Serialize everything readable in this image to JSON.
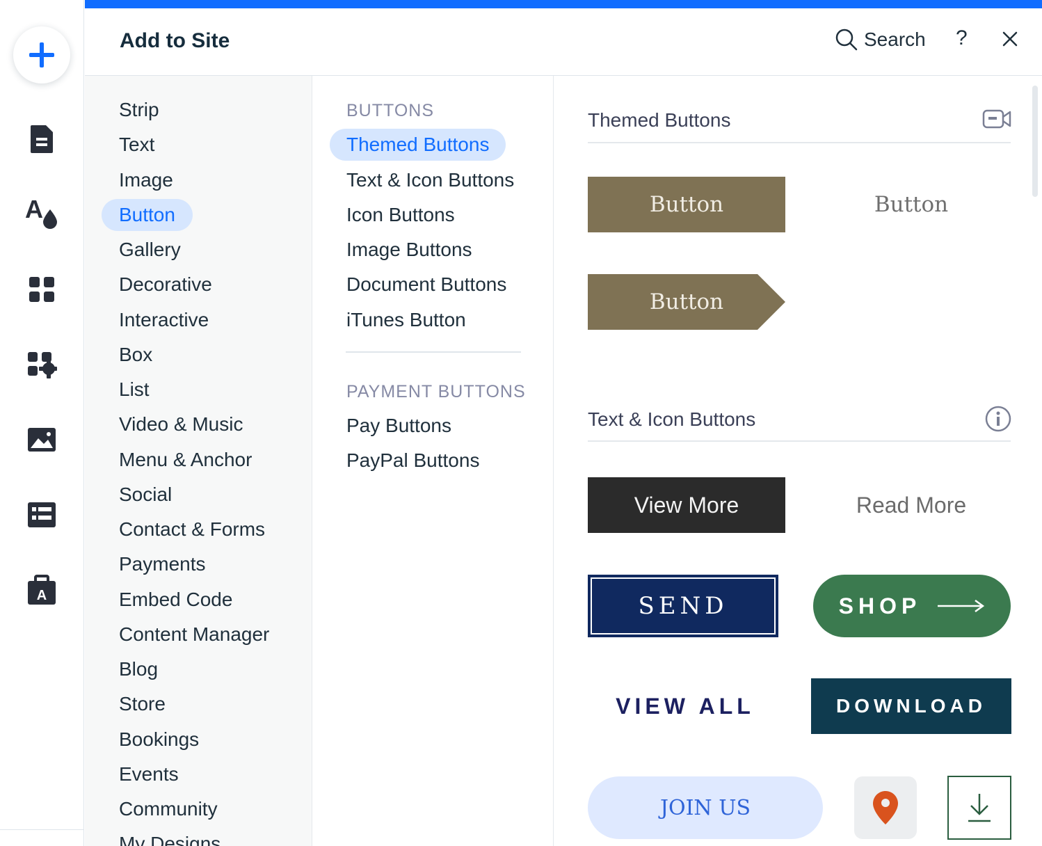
{
  "header": {
    "title": "Add to Site",
    "search_label": "Search",
    "help_label": "?"
  },
  "rail": {
    "icons": [
      "add-icon",
      "pages-icon",
      "theme-icon",
      "apps-icon",
      "app-market-icon",
      "media-icon",
      "cms-icon",
      "portfolio-icon"
    ]
  },
  "categories": {
    "items": [
      {
        "label": "Strip"
      },
      {
        "label": "Text"
      },
      {
        "label": "Image"
      },
      {
        "label": "Button"
      },
      {
        "label": "Gallery"
      },
      {
        "label": "Decorative"
      },
      {
        "label": "Interactive"
      },
      {
        "label": "Box"
      },
      {
        "label": "List"
      },
      {
        "label": "Video & Music"
      },
      {
        "label": "Menu & Anchor"
      },
      {
        "label": "Social"
      },
      {
        "label": "Contact & Forms"
      },
      {
        "label": "Payments"
      },
      {
        "label": "Embed Code"
      },
      {
        "label": "Content Manager"
      },
      {
        "label": "Blog"
      },
      {
        "label": "Store"
      },
      {
        "label": "Bookings"
      },
      {
        "label": "Events"
      },
      {
        "label": "Community"
      },
      {
        "label": "My Designs"
      }
    ],
    "selected": "Button"
  },
  "subcategories": {
    "heading_buttons": "BUTTONS",
    "buttons_items": [
      {
        "label": "Themed Buttons"
      },
      {
        "label": "Text & Icon Buttons"
      },
      {
        "label": "Icon Buttons"
      },
      {
        "label": "Image Buttons"
      },
      {
        "label": "Document Buttons"
      },
      {
        "label": "iTunes Button"
      }
    ],
    "selected": "Themed Buttons",
    "heading_payment": "PAYMENT BUTTONS",
    "payment_items": [
      {
        "label": "Pay Buttons"
      },
      {
        "label": "PayPal Buttons"
      }
    ]
  },
  "preview": {
    "themed": {
      "title": "Themed Buttons",
      "button1": "Button",
      "button2": "Button",
      "button3": "Button"
    },
    "text_icon": {
      "title": "Text & Icon Buttons",
      "view_more": "View More",
      "read_more": "Read More",
      "send": "SEND",
      "shop": "SHOP",
      "view_all": "VIEW ALL",
      "download": "DOWNLOAD",
      "join_us": "JOIN US"
    }
  },
  "colors": {
    "accent": "#116dff",
    "selected_bg": "#d6e6fe",
    "themed_button": "#7f7254",
    "send_bg": "#10295f",
    "shop_bg": "#3b7a4f",
    "download_bg": "#0f3b4f",
    "join_bg": "#dfe9ff",
    "pin": "#d9531e"
  }
}
